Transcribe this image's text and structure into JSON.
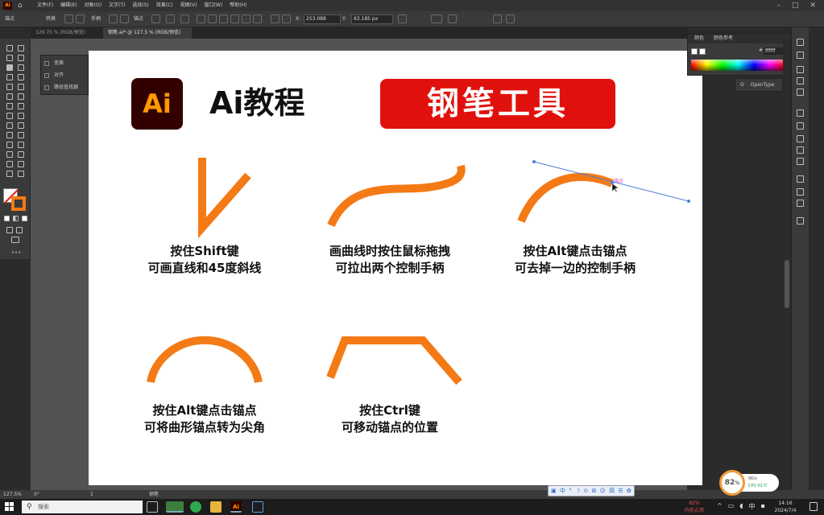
{
  "menubar": {
    "logo": "Ai",
    "menus": [
      "文件(F)",
      "编辑(E)",
      "对象(O)",
      "文字(T)",
      "选择(S)",
      "效果(C)",
      "视图(V)",
      "窗口(W)",
      "帮助(H)"
    ]
  },
  "control": {
    "anchor_label": "锚点",
    "convert_label": "转换",
    "handle_label": "手柄",
    "anchor2_label": "锚点",
    "x_label": "X:",
    "x_value": "253.088",
    "y_label": "Y:",
    "y_value": "63.185",
    "y_unit": "px"
  },
  "tabs": [
    {
      "label": "129.75 % (RGB/预览)",
      "active": false
    },
    {
      "label": "钢笔.ai* @ 127.5 % (RGB/预览)",
      "active": true
    }
  ],
  "flyout": {
    "items": [
      "变换",
      "对齐",
      "路径查找器"
    ]
  },
  "artboard": {
    "logo_text": "Ai",
    "title": "Ai教程",
    "banner": "钢笔工具",
    "anchor_tag": "锚点",
    "captions": [
      {
        "line1": "按住Shift键",
        "line2": "可画直线和45度斜线"
      },
      {
        "line1": "画曲线时按住鼠标拖拽",
        "line2": "可拉出两个控制手柄"
      },
      {
        "line1": "按住Alt键点击锚点",
        "line2": "可去掉一边的控制手柄"
      },
      {
        "line1": "按住Alt键点击锚点",
        "line2": "可将曲形锚点转为尖角"
      },
      {
        "line1": "按住Ctrl键",
        "line2": "可移动锚点的位置"
      }
    ],
    "stroke_color": "#f47a15"
  },
  "color_panel": {
    "tab1": "颜色",
    "tab2": "颜色参考",
    "hex_label": "#",
    "hex_value": "ffffff"
  },
  "opentype_panel": {
    "label": "OpenType"
  },
  "status": {
    "zoom": "127.5%",
    "rotate": "0°",
    "page": "1",
    "tool": "钢笔"
  },
  "ime": {
    "items": [
      "中",
      "°",
      "☽",
      "⊙",
      "⊞",
      "☺",
      "简",
      "☰",
      "✿"
    ]
  },
  "perf": {
    "percent": "82",
    "percent_unit": "%",
    "net": "0K/s",
    "cpu": "CPU 61℃"
  },
  "taskbar": {
    "search_placeholder": "搜索",
    "mem_value": "82%",
    "mem_label": "内存占用",
    "time": "14:16",
    "date": "2024/7/4",
    "ime_lang": "中"
  }
}
